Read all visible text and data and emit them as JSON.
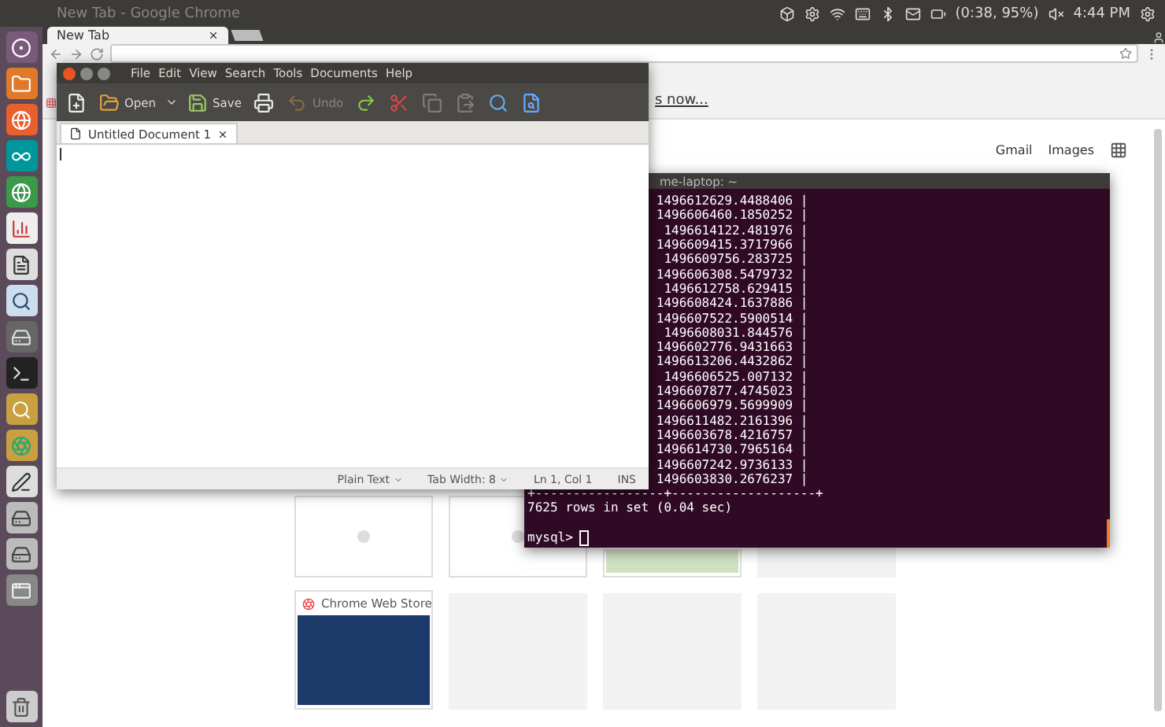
{
  "top_panel": {
    "title": "New Tab - Google Chrome",
    "battery": "(0:38, 95%)",
    "clock": "4:44 PM"
  },
  "browser": {
    "tabs": [
      {
        "label": "New Tab",
        "selected": true
      }
    ],
    "bookmark_link": "s now...",
    "links": [
      "Gmail",
      "Images"
    ],
    "tiles": [
      {
        "kind": "blank"
      },
      {
        "kind": "blank"
      },
      {
        "kind": "thumbnail"
      },
      {
        "kind": "empty"
      },
      {
        "kind": "site",
        "title": "Chrome Web Store"
      },
      {
        "kind": "empty"
      },
      {
        "kind": "empty"
      },
      {
        "kind": "empty"
      }
    ]
  },
  "text_editor": {
    "menu": [
      "File",
      "Edit",
      "View",
      "Search",
      "Tools",
      "Documents",
      "Help"
    ],
    "toolbar": [
      {
        "kind": "new",
        "disabled": false
      },
      {
        "kind": "open",
        "label": "Open",
        "disabled": false
      },
      {
        "kind": "save",
        "label": "Save",
        "disabled": false
      },
      {
        "kind": "print",
        "disabled": false
      },
      {
        "kind": "undo",
        "label": "Undo",
        "disabled": true
      },
      {
        "kind": "redo",
        "disabled": false
      },
      {
        "kind": "cut",
        "disabled": false
      },
      {
        "kind": "copy",
        "disabled": true
      },
      {
        "kind": "paste",
        "disabled": true
      },
      {
        "kind": "find",
        "disabled": false
      },
      {
        "kind": "replace",
        "disabled": false
      }
    ],
    "tabs": [
      {
        "label": "Untitled Document 1",
        "selected": true
      }
    ],
    "status": {
      "language": "Plain Text",
      "tab_width": "Tab Width: 8",
      "position": "Ln 1, Col 1",
      "mode": "INS"
    }
  },
  "terminal": {
    "title": "me-laptop: ~",
    "lines": [
      "1496612629.4488406 |",
      "1496606460.1850252 |",
      "1496614122.481976 |",
      "1496609415.3717966 |",
      "1496609756.283725 |",
      "1496606308.5479732 |",
      "1496612758.629415 |",
      "1496608424.1637886 |",
      "1496607522.5900514 |",
      "1496608031.844576 |",
      "1496602776.9431663 |",
      "1496613206.4432862 |",
      "1496606525.007132 |",
      "1496607877.4745023 |",
      "1496606979.5699909 |",
      "1496611482.2161396 |",
      "1496603678.4216757 |",
      "1496614730.7965164 |",
      "1496607242.9736133 |",
      "1496603830.2676237 |"
    ],
    "separator": "+-----------------+-------------------+",
    "result": "7625 rows in set (0.04 sec)",
    "prompt": "mysql>"
  }
}
